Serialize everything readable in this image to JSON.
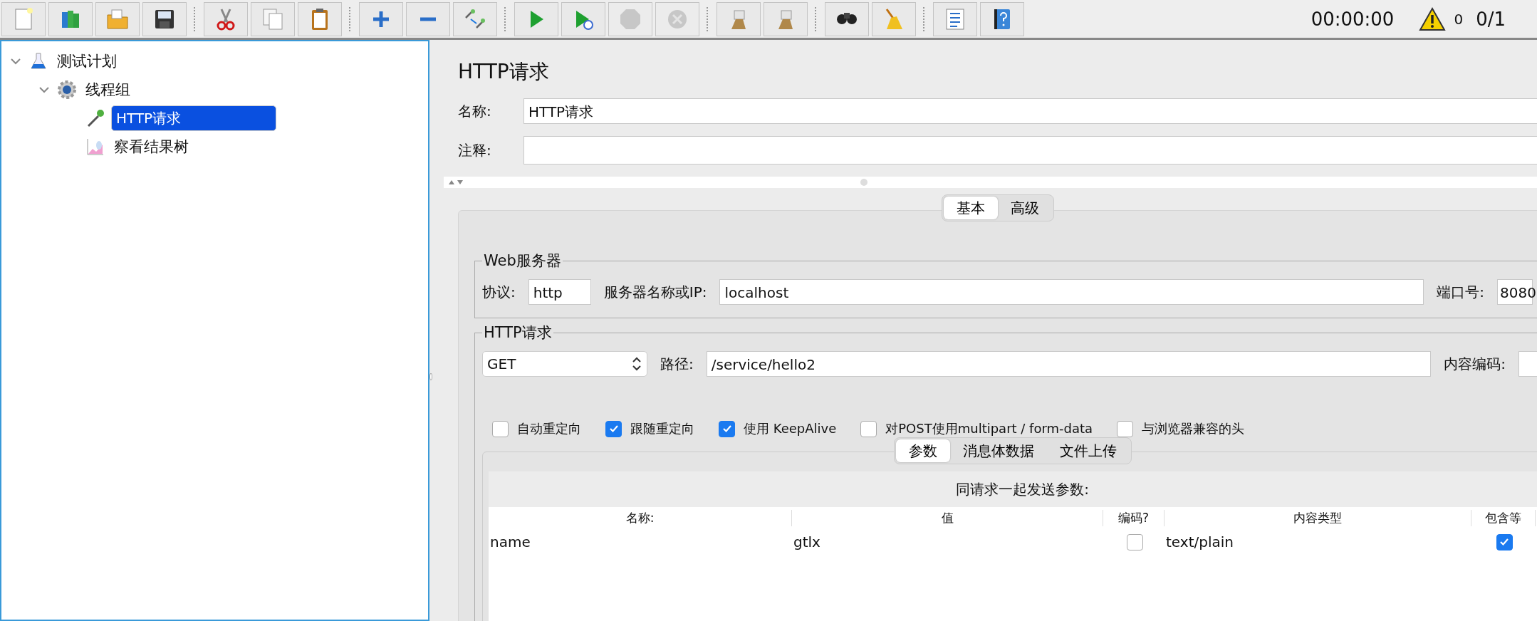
{
  "toolbar": {
    "groups": [
      [
        {
          "kind": "new",
          "disabled": false
        },
        {
          "kind": "templates",
          "disabled": false
        },
        {
          "kind": "open",
          "disabled": false
        },
        {
          "kind": "save",
          "disabled": false
        }
      ],
      [
        {
          "kind": "cut",
          "disabled": false
        },
        {
          "kind": "copy",
          "disabled": false
        },
        {
          "kind": "paste",
          "disabled": false
        }
      ],
      [
        {
          "kind": "add",
          "disabled": false
        },
        {
          "kind": "remove",
          "disabled": false
        },
        {
          "kind": "toggle",
          "disabled": false
        }
      ],
      [
        {
          "kind": "start",
          "disabled": false
        },
        {
          "kind": "start-no-pause",
          "disabled": false
        },
        {
          "kind": "stop",
          "disabled": true
        },
        {
          "kind": "shutdown",
          "disabled": true
        }
      ],
      [
        {
          "kind": "clear",
          "disabled": false
        },
        {
          "kind": "clear-all",
          "disabled": false
        }
      ],
      [
        {
          "kind": "search",
          "disabled": false
        },
        {
          "kind": "reset",
          "disabled": false
        }
      ],
      [
        {
          "kind": "functions",
          "disabled": false
        },
        {
          "kind": "help",
          "disabled": false
        }
      ]
    ],
    "timer": "00:00:00",
    "warnings": "0",
    "threads": "0/1"
  },
  "tree": [
    {
      "label": "测试计划",
      "kind": "plan",
      "expanded": true,
      "selected": false,
      "children": [
        {
          "label": "线程组",
          "kind": "thread-group",
          "expanded": true,
          "selected": false,
          "children": [
            {
              "label": "HTTP请求",
              "kind": "sampler",
              "selected": true
            },
            {
              "label": "察看结果树",
              "kind": "listener",
              "selected": false
            }
          ]
        }
      ]
    }
  ],
  "editor": {
    "title": "HTTP请求",
    "name_field": {
      "label": "名称:",
      "value": "HTTP请求"
    },
    "comment_field": {
      "label": "注释:"
    },
    "tabs": [
      {
        "label": "基本",
        "selected": true
      },
      {
        "label": "高级",
        "selected": false
      }
    ],
    "web_server": {
      "legend": "Web服务器",
      "protocol": {
        "label": "协议:",
        "value": "http"
      },
      "server": {
        "label": "服务器名称或IP:",
        "value": "localhost"
      },
      "port": {
        "label": "端口号:",
        "value": "8080"
      }
    },
    "http_request": {
      "legend": "HTTP请求",
      "method": {
        "value": "GET"
      },
      "path": {
        "label": "路径:",
        "value": "/service/hello2"
      },
      "encoding": {
        "label": "内容编码:"
      },
      "options": [
        {
          "label": "自动重定向",
          "checked": false
        },
        {
          "label": "跟随重定向",
          "checked": true
        },
        {
          "label": "使用 KeepAlive",
          "checked": true
        },
        {
          "label": "对POST使用multipart / form-data",
          "checked": false
        },
        {
          "label": "与浏览器兼容的头",
          "checked": false
        }
      ]
    },
    "sub_tabs": [
      {
        "label": "参数",
        "selected": true
      },
      {
        "label": "消息体数据",
        "selected": false
      },
      {
        "label": "文件上传",
        "selected": false
      }
    ],
    "params": {
      "caption": "同请求一起发送参数:",
      "columns": [
        "名称:",
        "值",
        "编码?",
        "内容类型",
        "包含等"
      ],
      "rows": [
        {
          "name": "name",
          "value": "gtlx",
          "encode": false,
          "content_type": "text/plain",
          "include_equals": true
        }
      ]
    }
  }
}
